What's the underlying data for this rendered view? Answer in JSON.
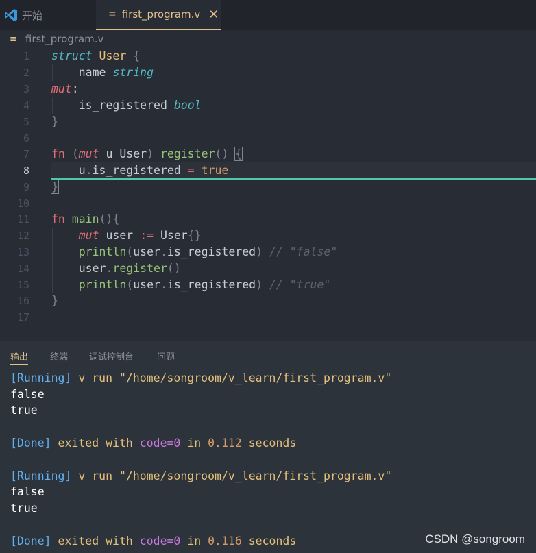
{
  "tabs": [
    {
      "label": "开始",
      "icon": "vscode-logo-icon"
    },
    {
      "label": "first_program.v",
      "icon": "file-lines-icon",
      "close": "✕"
    }
  ],
  "breadcrumb": {
    "label": "first_program.v"
  },
  "editor": {
    "current_line": 8,
    "lines": [
      {
        "n": "1"
      },
      {
        "n": "2"
      },
      {
        "n": "3"
      },
      {
        "n": "4"
      },
      {
        "n": "5"
      },
      {
        "n": "6"
      },
      {
        "n": "7"
      },
      {
        "n": "8"
      },
      {
        "n": "9"
      },
      {
        "n": "10"
      },
      {
        "n": "11"
      },
      {
        "n": "12"
      },
      {
        "n": "13"
      },
      {
        "n": "14"
      },
      {
        "n": "15"
      },
      {
        "n": "16"
      },
      {
        "n": "17"
      }
    ],
    "tokens": {
      "l1": [
        "struct",
        "User",
        "{"
      ],
      "l2": [
        "name",
        "string"
      ],
      "l3": [
        "mut",
        ":"
      ],
      "l4": [
        "is_registered",
        "bool"
      ],
      "l5": [
        "}"
      ],
      "l7": [
        "fn",
        "(",
        "mut",
        "u",
        "User",
        ")",
        "register",
        "()",
        "{"
      ],
      "l8": [
        "u",
        ".",
        "is_registered",
        "=",
        "true"
      ],
      "l9": [
        "}"
      ],
      "l11": [
        "fn",
        "main",
        "(){"
      ],
      "l12": [
        "mut",
        "user",
        ":=",
        "User",
        "{}"
      ],
      "l13": [
        "println",
        "(",
        "user",
        ".",
        "is_registered",
        ")",
        "// \"false\""
      ],
      "l14": [
        "user",
        ".",
        "register",
        "()"
      ],
      "l15": [
        "println",
        "(",
        "user",
        ".",
        "is_registered",
        ")",
        "// \"true\""
      ],
      "l16": [
        "}"
      ]
    }
  },
  "panel": {
    "tabs": [
      "输出",
      "终端",
      "调试控制台",
      "问题"
    ],
    "active_tab": "输出",
    "output": [
      {
        "running": "[Running]",
        "cmd": "v run \"/home/songroom/v_learn/first_program.v\""
      },
      {
        "text": "false"
      },
      {
        "text": "true"
      },
      {
        "done": "[Done]",
        "exited": "exited with",
        "code": "code=0",
        "in": "in",
        "secs": "0.112",
        "unit": "seconds"
      },
      {
        "running": "[Running]",
        "cmd": "v run \"/home/songroom/v_learn/first_program.v\""
      },
      {
        "text": "false"
      },
      {
        "text": "true"
      },
      {
        "done": "[Done]",
        "exited": "exited with",
        "code": "code=0",
        "in": "in",
        "secs": "0.116",
        "unit": "seconds"
      }
    ]
  },
  "watermark": "CSDN @songroom",
  "colors": {
    "accent": "#e2c08d",
    "current_line_border": "#4ec9b0",
    "editor_bg": "#282c34",
    "panel_bg": "#2d333b"
  }
}
